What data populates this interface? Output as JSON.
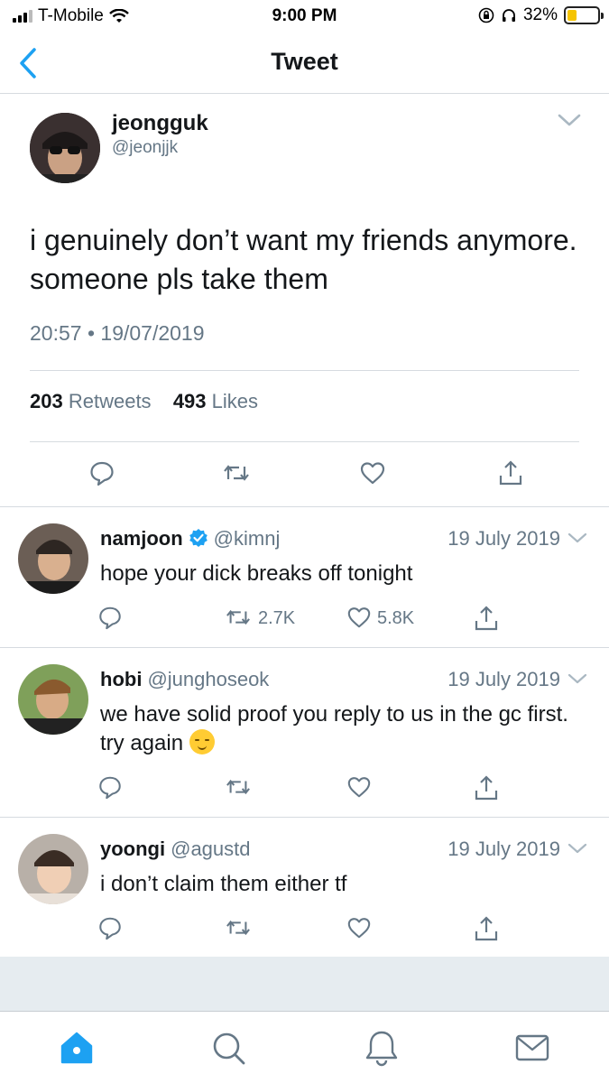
{
  "status_bar": {
    "carrier": "T-Mobile",
    "time": "9:00 PM",
    "battery": "32%",
    "battery_level": 0.32,
    "icons": [
      "signal-icon",
      "wifi-icon",
      "orientation-lock-icon",
      "headphones-icon",
      "battery-icon"
    ]
  },
  "header": {
    "title": "Tweet",
    "back_icon": "chevron-left-icon"
  },
  "main_tweet": {
    "name": "jeongguk",
    "handle": "@jeonjjk",
    "text": "i genuinely don’t want my friends anymore. someone pls take them",
    "time": "20:57",
    "separator": "•",
    "date": "19/07/2019",
    "retweets_count": "203",
    "retweets_label": "Retweets",
    "likes_count": "493",
    "likes_label": "Likes",
    "actions": [
      "reply-icon",
      "retweet-icon",
      "like-icon",
      "share-icon"
    ]
  },
  "replies": [
    {
      "name": "namjoon",
      "verified": true,
      "handle": "@kimnj",
      "date": "19 July 2019",
      "text": "hope your dick breaks off tonight",
      "retweets": "2.7K",
      "likes": "5.8K"
    },
    {
      "name": "hobi",
      "verified": false,
      "handle": "@junghoseok",
      "date": "19 July 2019",
      "text": "we have solid proof you  reply to us in the gc first. try again",
      "emoji": "relieved-face",
      "retweets": "",
      "likes": ""
    },
    {
      "name": "yoongi",
      "verified": false,
      "handle": "@agustd",
      "date": "19 July 2019",
      "text": "i don’t claim them either tf",
      "retweets": "",
      "likes": ""
    }
  ],
  "tab_bar": {
    "items": [
      "home-icon",
      "search-icon",
      "notifications-icon",
      "messages-icon"
    ],
    "active": "home-icon",
    "accent": "#1da1f2"
  },
  "colors": {
    "accent": "#1da1f2",
    "secondary_text": "#657786",
    "divider": "#d6dbe0",
    "battery_fill": "#f5c400"
  }
}
